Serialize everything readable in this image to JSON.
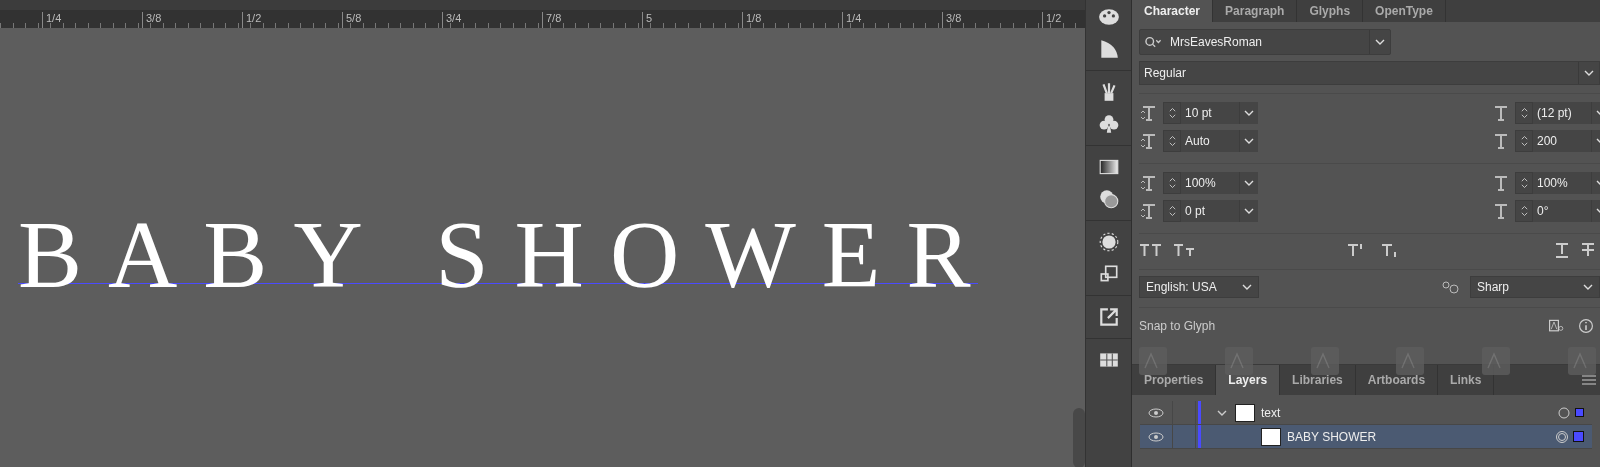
{
  "ruler": {
    "labels": [
      "1/4",
      "3/8",
      "1/2",
      "5/8",
      "3/4",
      "7/8",
      "5",
      "1/8",
      "1/4",
      "3/8",
      "1/2"
    ]
  },
  "canvas": {
    "text": "BABY SHOWER"
  },
  "character_panel": {
    "tabs": [
      {
        "label": "Character",
        "selected": true
      },
      {
        "label": "Paragraph",
        "selected": false
      },
      {
        "label": "Glyphs",
        "selected": false
      },
      {
        "label": "OpenType",
        "selected": false
      }
    ],
    "font_family": "MrsEavesRoman",
    "font_style": "Regular",
    "fields": [
      {
        "value": "10 pt"
      },
      {
        "value": "(12 pt)"
      },
      {
        "value": "Auto"
      },
      {
        "value": "200"
      },
      {
        "value": "100%"
      },
      {
        "value": "100%"
      },
      {
        "value": "0 pt"
      },
      {
        "value": "0°"
      }
    ],
    "language": "English: USA",
    "anti_aliasing": "Sharp",
    "snap_label": "Snap to Glyph"
  },
  "layers_panel": {
    "tabs": [
      {
        "label": "Properties",
        "selected": false
      },
      {
        "label": "Layers",
        "selected": true
      },
      {
        "label": "Libraries",
        "selected": false
      },
      {
        "label": "Artboards",
        "selected": false
      },
      {
        "label": "Links",
        "selected": false
      }
    ],
    "layers": [
      {
        "name": "text",
        "expanded": true,
        "selected": false,
        "children": [
          {
            "name": "BABY SHOWER",
            "selected": true
          }
        ]
      }
    ]
  }
}
